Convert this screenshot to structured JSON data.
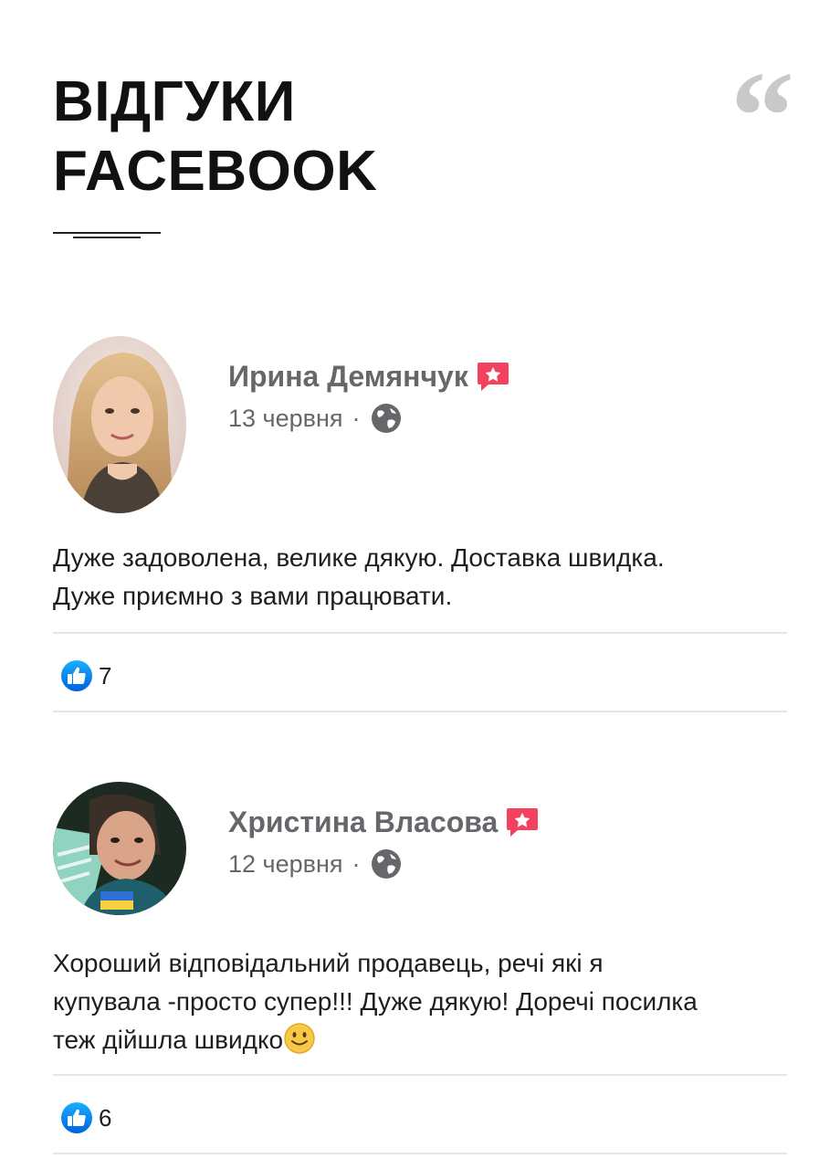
{
  "header": {
    "title_line1": "ВІДГУКИ",
    "title_line2": "FACEBOOK",
    "quote_glyph": "“"
  },
  "reviews": [
    {
      "author": "Ирина Демянчук",
      "date": "13 червня",
      "separator": "·",
      "text_line1": "Дуже задоволена, велике дякую. Доставка швидка.",
      "text_line2": "Дуже приємно з вами працювати.",
      "likes": "7",
      "badge_icon": "recommend-badge-icon",
      "privacy_icon": "globe-icon",
      "reaction_icon": "like-icon"
    },
    {
      "author": "Христина Власова",
      "date": "12 червня",
      "separator": "·",
      "text_line1": "Хороший відповідальний продавець, речі які я",
      "text_line2": "купувала -просто супер!!! Дуже дякую! Доречі посилка",
      "text_line3": "теж дійшла швидко",
      "likes": "6",
      "badge_icon": "recommend-badge-icon",
      "privacy_icon": "globe-icon",
      "reaction_icon": "like-icon"
    }
  ],
  "colors": {
    "accent_blue": "#1877f2",
    "badge_red": "#f3425f",
    "meta_gray": "#65676b",
    "divider": "#e4e6eb"
  }
}
